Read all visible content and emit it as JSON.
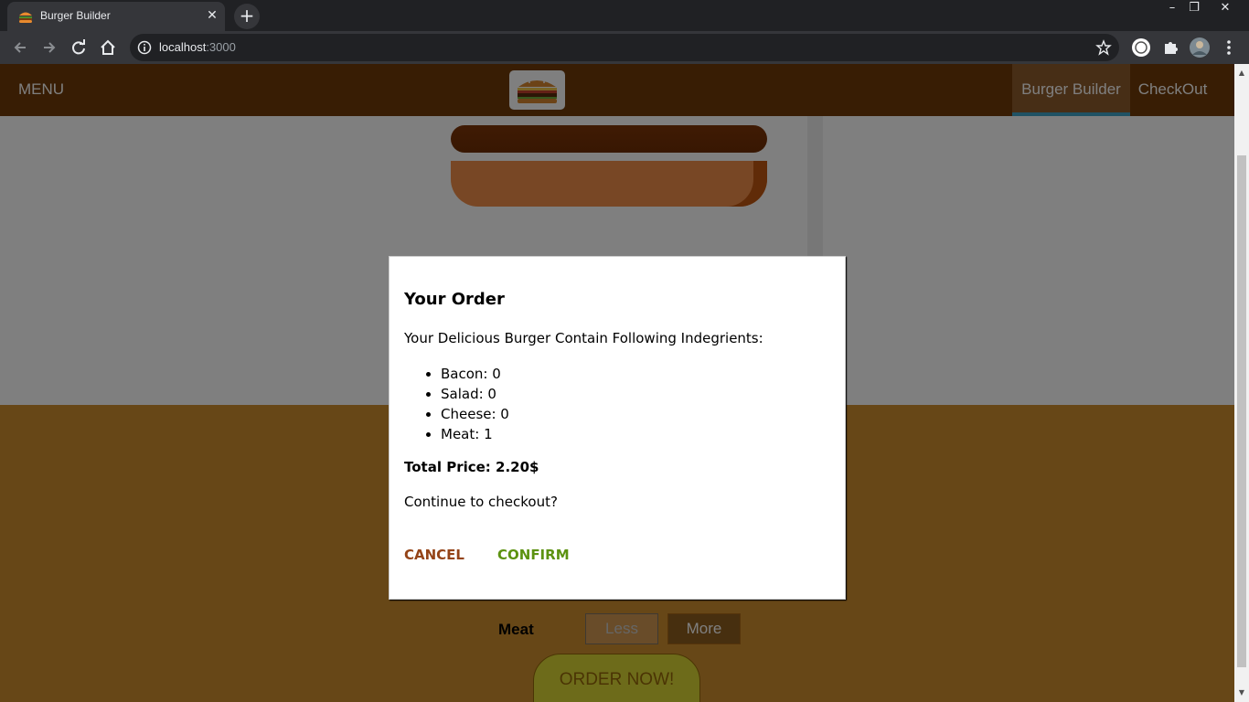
{
  "browser": {
    "tab_title": "Burger Builder",
    "url_host": "localhost",
    "url_port": ":3000"
  },
  "app": {
    "menu_label": "MENU",
    "nav": [
      {
        "label": "Burger Builder",
        "active": true
      },
      {
        "label": "CheckOut",
        "active": false
      }
    ]
  },
  "controls": {
    "label": "Meat",
    "less_label": "Less",
    "more_label": "More",
    "order_label": "ORDER NOW!"
  },
  "modal": {
    "title": "Your Order",
    "intro": "Your Delicious Burger Contain Following Indegrients:",
    "ingredients": [
      "Bacon: 0",
      "Salad: 0",
      "Cheese: 0",
      "Meat: 1"
    ],
    "total": "Total Price: 2.20$",
    "question": "Continue to checkout?",
    "cancel_label": "CANCEL",
    "confirm_label": "CONFIRM"
  },
  "colors": {
    "toolbar": "#703b09",
    "cancel": "#944317",
    "confirm": "#5c9210",
    "controls_bg": "#cf8f2e"
  }
}
